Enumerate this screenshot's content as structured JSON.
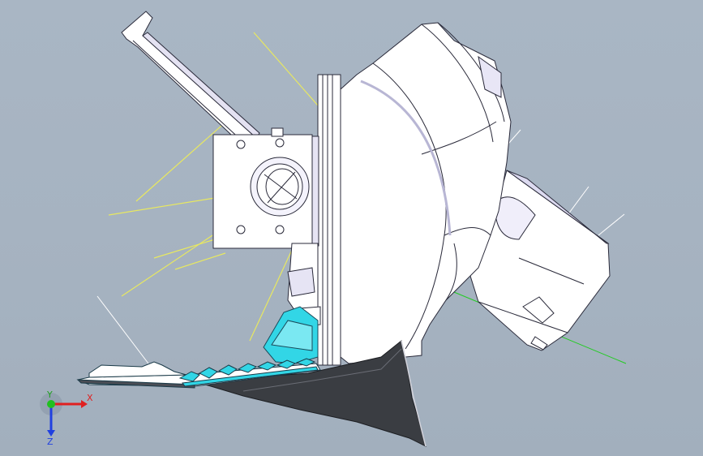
{
  "view": {
    "background_top": "#a9b6c4",
    "background_bottom": "#a2afbd",
    "part_fill": "#ffffff",
    "part_edge": "#2a2a3a",
    "part_shadow": "#d8d6ee",
    "highlight_fill": "#32d6e6",
    "blade_fill": "#3a3d42",
    "sketch_yellow": "#e8e860",
    "sketch_white": "#ffffff",
    "sketch_green": "#22cc22"
  },
  "triad": {
    "x_label": "X",
    "y_label": "Y",
    "z_label": "Z",
    "x_color": "#e02020",
    "y_color": "#20c020",
    "z_color": "#2040e0"
  }
}
